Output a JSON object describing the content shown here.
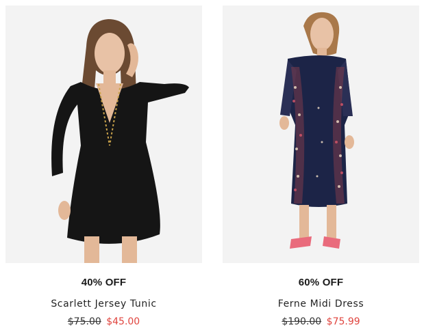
{
  "products": [
    {
      "discount": "40% OFF",
      "name": "Scarlett Jersey Tunic",
      "price_old": "$75.00",
      "price_new": "$45.00"
    },
    {
      "discount": "60% OFF",
      "name": "Ferne Midi Dress",
      "price_old": "$190.00",
      "price_new": "$75.99"
    }
  ],
  "colors": {
    "sale_price": "#e0443e",
    "image_background": "#f2f2f2",
    "text": "#1a1a1a"
  }
}
